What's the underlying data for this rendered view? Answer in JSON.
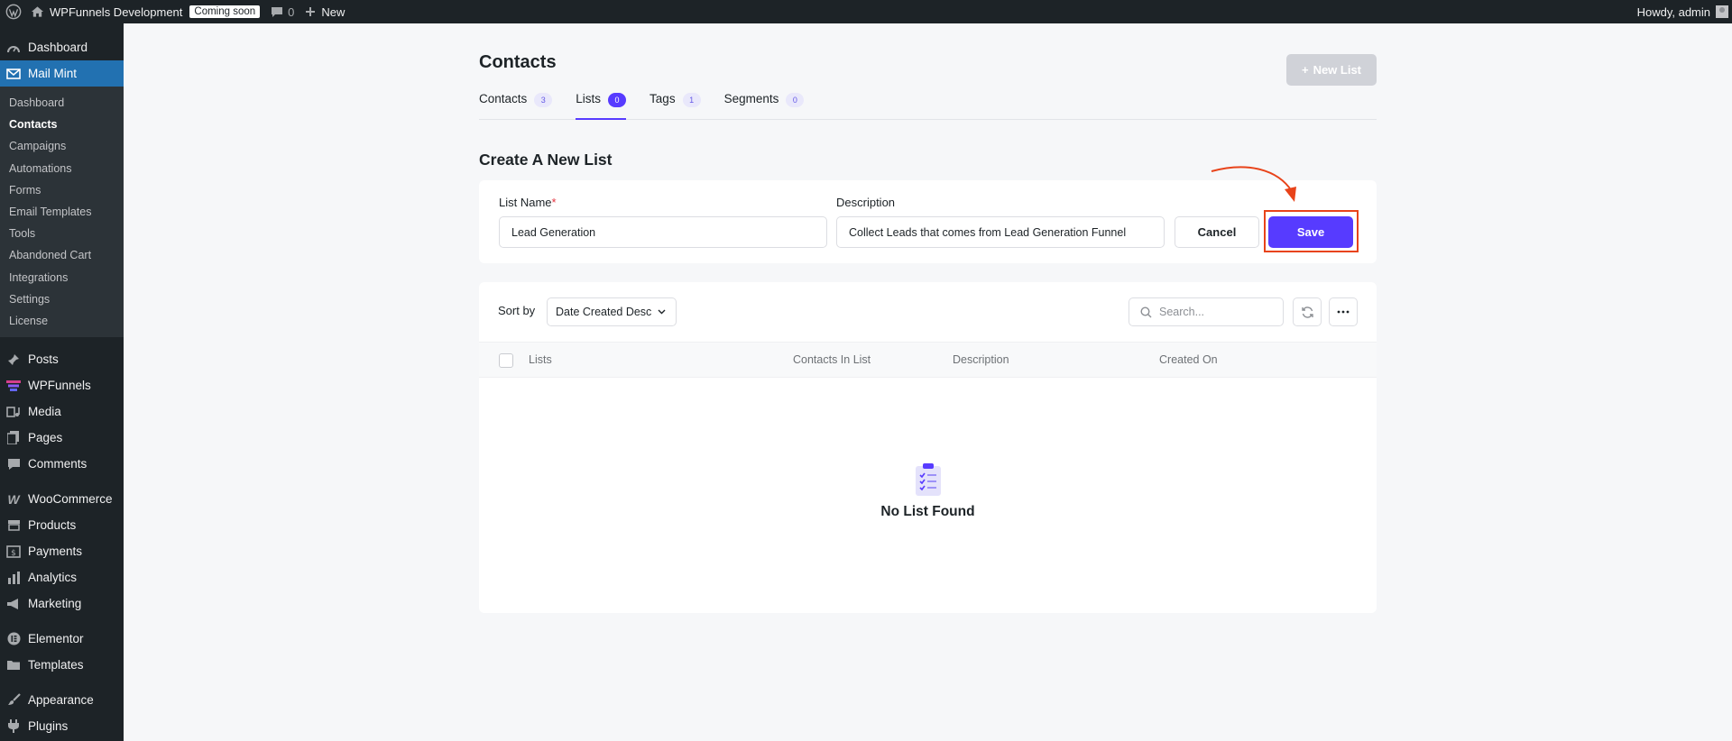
{
  "admin_bar": {
    "site_name": "WPFunnels Development",
    "coming_soon": "Coming soon",
    "comments_count": "0",
    "new_label": "New",
    "howdy": "Howdy, admin"
  },
  "sidebar": {
    "dashboard": "Dashboard",
    "mail_mint": "Mail Mint",
    "submenu": [
      "Dashboard",
      "Contacts",
      "Campaigns",
      "Automations",
      "Forms",
      "Email Templates",
      "Tools",
      "Abandoned Cart",
      "Integrations",
      "Settings",
      "License"
    ],
    "group1": [
      "Posts",
      "WPFunnels",
      "Media",
      "Pages",
      "Comments"
    ],
    "group2": [
      "WooCommerce",
      "Products",
      "Payments",
      "Analytics",
      "Marketing"
    ],
    "group3": [
      "Elementor",
      "Templates"
    ],
    "group4": [
      "Appearance",
      "Plugins"
    ]
  },
  "header": {
    "title": "Contacts",
    "new_list_label": "New List"
  },
  "tabs": [
    {
      "label": "Contacts",
      "count": "3"
    },
    {
      "label": "Lists",
      "count": "0"
    },
    {
      "label": "Tags",
      "count": "1"
    },
    {
      "label": "Segments",
      "count": "0"
    }
  ],
  "form": {
    "section_title": "Create A New List",
    "list_name_label": "List Name",
    "required_mark": "*",
    "list_name_value": "Lead Generation",
    "description_label": "Description",
    "description_value": "Collect Leads that comes from Lead Generation Funnel",
    "cancel_label": "Cancel",
    "save_label": "Save"
  },
  "list_table": {
    "sort_label": "Sort by",
    "sort_value": "Date Created Desc",
    "search_placeholder": "Search...",
    "columns": [
      "Lists",
      "Contacts In List",
      "Description",
      "Created On"
    ],
    "empty_text": "No List Found"
  },
  "colors": {
    "accent": "#573bff",
    "highlight": "#e8431a",
    "admin_bg": "#1d2327",
    "menu_current": "#2271b1"
  }
}
